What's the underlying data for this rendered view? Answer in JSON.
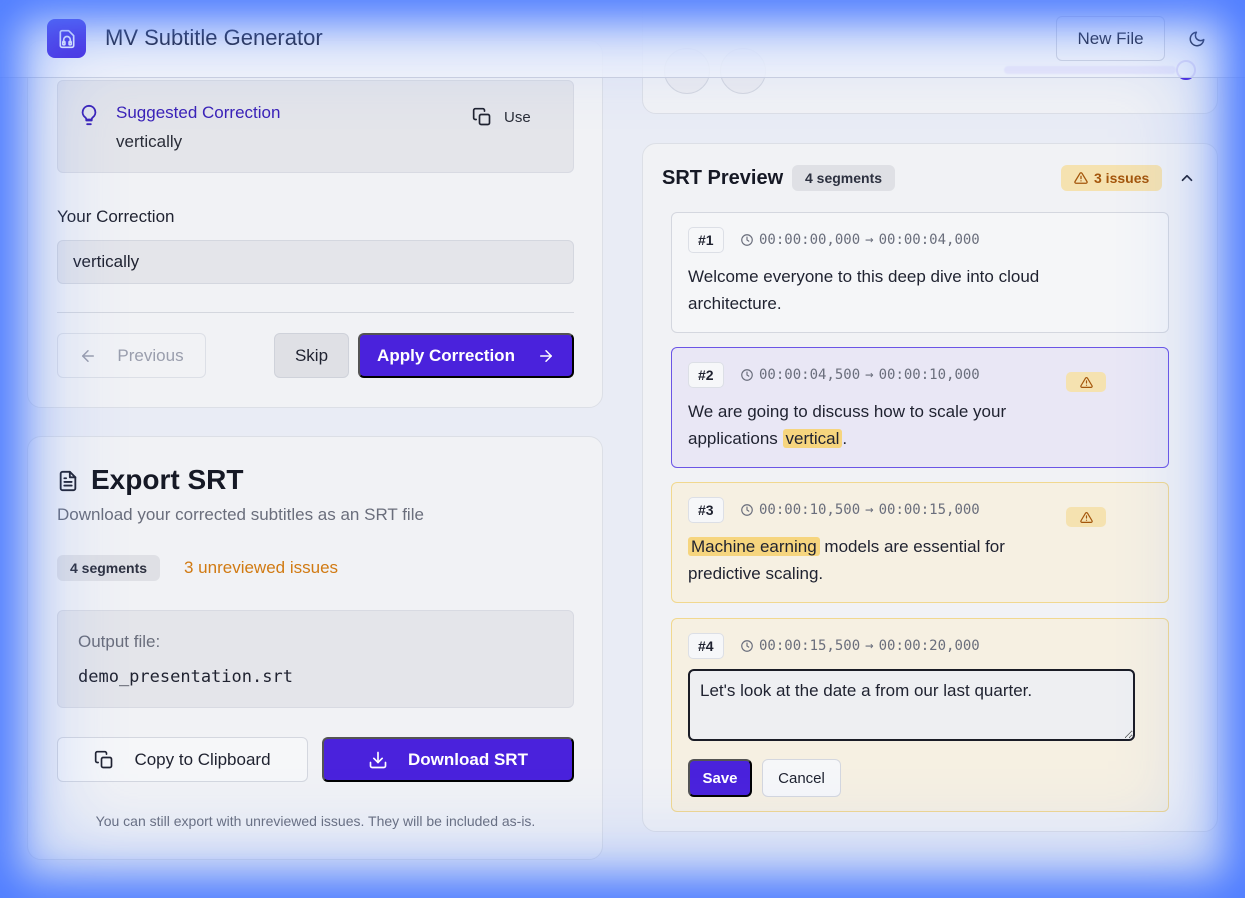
{
  "header": {
    "app_title": "MV Subtitle Generator",
    "new_file_label": "New File"
  },
  "correction": {
    "suggested_title": "Suggested Correction",
    "suggested_value": "vertically",
    "use_label": "Use",
    "your_correction_label": "Your Correction",
    "your_correction_value": "vertically",
    "previous_label": "Previous",
    "skip_label": "Skip",
    "apply_label": "Apply Correction"
  },
  "export": {
    "title": "Export SRT",
    "subtitle": "Download your corrected subtitles as an SRT file",
    "segments_badge": "4 segments",
    "unreviewed": "3 unreviewed issues",
    "output_label": "Output file:",
    "output_file": "demo_presentation.srt",
    "copy_label": "Copy to Clipboard",
    "download_label": "Download SRT",
    "note": "You can still export with unreviewed issues. They will be included as-is."
  },
  "preview": {
    "title": "SRT Preview",
    "segments_badge": "4 segments",
    "issues_badge": "3 issues",
    "segments": [
      {
        "num": "#1",
        "start": "00:00:00,000",
        "end": "00:00:04,000",
        "text": "Welcome everyone to this deep dive into cloud architecture."
      },
      {
        "num": "#2",
        "start": "00:00:04,500",
        "end": "00:00:10,000",
        "text_before": "We are going to discuss how to scale your applications ",
        "highlight": "vertical",
        "text_after": "."
      },
      {
        "num": "#3",
        "start": "00:00:10,500",
        "end": "00:00:15,000",
        "highlight": "Machine earning",
        "text_after": " models are essential for predictive scaling."
      },
      {
        "num": "#4",
        "start": "00:00:15,500",
        "end": "00:00:20,000",
        "edit_value": "Let's look at the date a from our last quarter.",
        "save_label": "Save",
        "cancel_label": "Cancel"
      }
    ],
    "arrow": "→"
  },
  "colors": {
    "accent": "#4a22dc",
    "warning": "#d17a12",
    "highlight": "#f6d57e"
  }
}
